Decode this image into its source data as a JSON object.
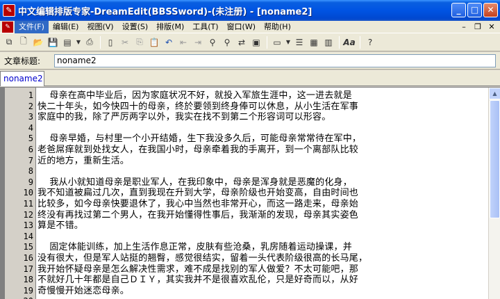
{
  "window": {
    "title": "中文编辑排版专家-DreamEdit(BBSSword)-(未注册) - [noname2]",
    "app_icon": "app-icon",
    "buttons": [
      "minimize",
      "maximize",
      "close"
    ]
  },
  "menubar": {
    "items": [
      "文件(F)",
      "编辑(E)",
      "视图(V)",
      "设置(S)",
      "排版(M)",
      "工具(T)",
      "窗口(W)",
      "帮助(H)"
    ],
    "active_index": 0
  },
  "toolbar": {
    "icons": [
      "new-icon",
      "open-icon",
      "save-icon",
      "dropdown-icon",
      "print-icon",
      "cut-icon",
      "copy-icon",
      "paste-icon",
      "undo-icon",
      "outdent-icon",
      "indent-icon",
      "find-icon",
      "find-next-icon",
      "replace-icon",
      "clipboard-icon",
      "format-icon",
      "dropdown-icon",
      "layout-icon",
      "layout2-icon",
      "layout3-icon",
      "font-icon",
      "help-icon"
    ]
  },
  "title_field": {
    "label": "文章标题:",
    "value": "noname2"
  },
  "tabs": [
    "noname2"
  ],
  "editor": {
    "line_numbers": [
      "1",
      "2",
      "3",
      "4",
      "5",
      "6",
      "7",
      "8",
      "9",
      "10",
      "11",
      "12",
      "13",
      "14",
      "15",
      "16",
      "17",
      "18",
      "19",
      "20"
    ],
    "lines": [
      "    母亲在高中毕业后，因为家庭状况不好，就投入军旅生涯中，这一进去就是",
      "快二十年头，如今快四十的母亲，终於要领到终身俸可以休息，从小生活在军事",
      "家庭中的我，除了严厉两字以外，我实在找不到第二个形容词可以形容。",
      "",
      "    母亲早婚，与村里一个小开结婚，生下我没多久后，可能母亲常常待在军中，",
      "老爸屌痒就到处找女人，在我国小时，母亲牵着我的手离开，到一个离部队比较",
      "近的地方，重新生活。",
      "",
      "    我从小就知道母亲是职业军人，在我印象中，母亲是浑身就是恶魔的化身，",
      "我不知道被扁过几次，直到我现在升到大学，母亲阶级也开始变高，自由时间也",
      "比较多，如今母亲快要退休了，我心中当然也非常开心，而这一路走来，母亲始",
      "终没有再找过第二个男人，在我开始懂得性事后，我渐渐的发现，母亲其实姿色",
      "算是不错。",
      "",
      "    固定体能训练，加上生活作息正常，皮肤有些沧桑，乳房随着运动操课，并",
      "没有很大，但是军人站挺的翘臀，感觉很结实，留着一头代表阶级很高的长马尾，",
      "我开始怀疑母亲是怎么解决性需求，难不成是找别的军人做爱？不太可能吧，那",
      "不就好几十年都是自己ＤＩＹ，其实我并不是很喜欢乱伦，只是好奇而以，从好",
      "奇慢慢开始迷恋母亲。",
      ""
    ]
  }
}
